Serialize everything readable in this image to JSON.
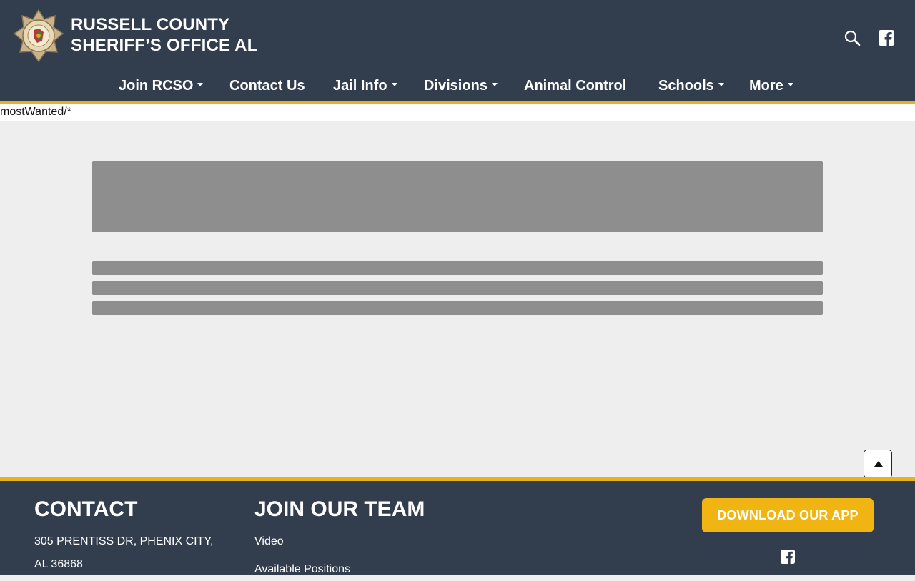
{
  "header": {
    "title_line1": "RUSSELL COUNTY",
    "title_line2": "SHERIFF’S OFFICE AL",
    "logo_icon": "sheriff-badge-seal",
    "search_icon": "search-icon",
    "facebook_icon": "facebook-icon"
  },
  "nav": {
    "items": [
      {
        "label": "Join RCSO",
        "has_menu": true
      },
      {
        "label": "Contact Us",
        "has_menu": false
      },
      {
        "label": "Jail Info",
        "has_menu": true
      },
      {
        "label": "Divisions",
        "has_menu": true
      },
      {
        "label": "Animal Control",
        "has_menu": false
      },
      {
        "label": "Schools",
        "has_menu": true
      },
      {
        "label": "More",
        "has_menu": true
      }
    ]
  },
  "path_text": "mostWanted/*",
  "footer": {
    "contact_heading": "CONTACT",
    "address_line1": "305 PRENTISS DR, PHENIX CITY,",
    "address_line2": "AL 36868",
    "join_heading": "JOIN OUR TEAM",
    "join_links": [
      "Video",
      "Available Positions"
    ],
    "app_button": "DOWNLOAD OUR APP"
  },
  "colors": {
    "header_bg": "#323d4e",
    "accent": "#e7b21e",
    "app_button": "#f0b413",
    "skeleton": "#8e8e8e",
    "page_bg": "#eeeeee"
  }
}
